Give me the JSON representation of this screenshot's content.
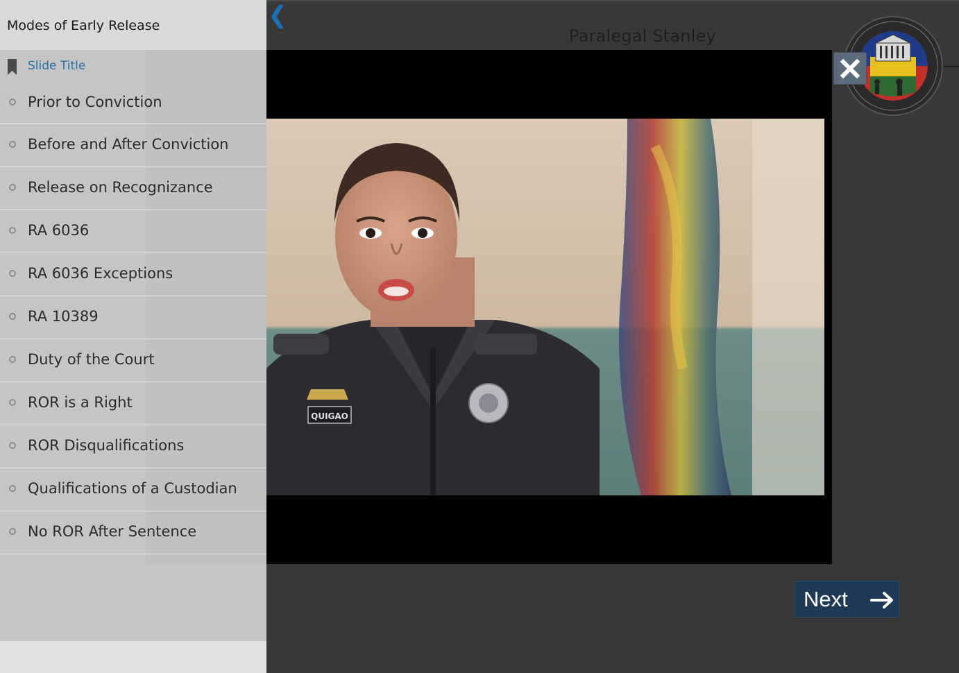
{
  "slide": {
    "title": "Paralegal Stanley"
  },
  "sidebar": {
    "course_title": "Modes of Early Release",
    "outline_header": "Slide Title",
    "items": [
      {
        "label": "Prior to Conviction"
      },
      {
        "label": "Before and After Conviction"
      },
      {
        "label": "Release on Recognizance"
      },
      {
        "label": "RA 6036"
      },
      {
        "label": "RA 6036 Exceptions"
      },
      {
        "label": "RA 10389"
      },
      {
        "label": "Duty of the Court"
      },
      {
        "label": "ROR is a Right"
      },
      {
        "label": "ROR Disqualifications"
      },
      {
        "label": "Qualifications of a Custodian"
      },
      {
        "label": "No ROR After Sentence"
      }
    ]
  },
  "video": {
    "name_tag": "QUIGAO"
  },
  "controls": {
    "next_label": "Next",
    "close_icon": "close-icon",
    "back_icon": "chevron-left-icon"
  },
  "colors": {
    "next_bg": "#1f3a57",
    "accent_link": "#2670a3",
    "close_bg": "#5d6c7c",
    "chevron": "#1b6fb5"
  }
}
